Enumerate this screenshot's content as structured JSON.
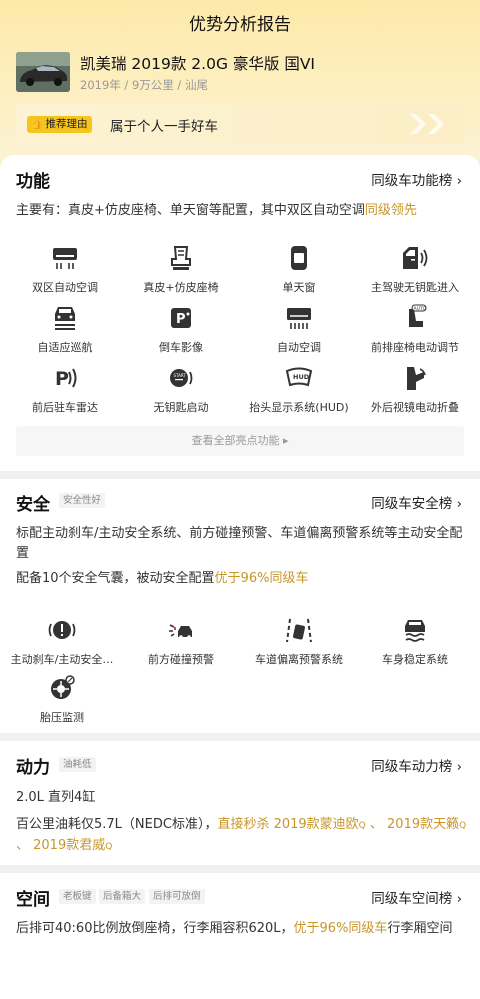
{
  "page": {
    "title": "优势分析报告"
  },
  "car": {
    "name": "凯美瑞 2019款 2.0G 豪华版 国VI",
    "meta": "2019年 / 9万公里 / 汕尾"
  },
  "reason": {
    "tag": "推荐理由",
    "text": "属于个人一手好车"
  },
  "function": {
    "title": "功能",
    "rank_link": "同级车功能榜 ›",
    "summary_prefix": "主要有：真皮+仿皮座椅、单天窗等配置，其中双区自动空调",
    "summary_highlight": "同级领先",
    "features": [
      {
        "label": "双区自动空调",
        "icon": "dual-zone-ac-icon"
      },
      {
        "label": "真皮+仿皮座椅",
        "icon": "leather-seat-icon"
      },
      {
        "label": "单天窗",
        "icon": "sunroof-icon"
      },
      {
        "label": "主驾驶无钥匙进入",
        "icon": "keyless-entry-icon"
      },
      {
        "label": "自适应巡航",
        "icon": "adaptive-cruise-icon"
      },
      {
        "label": "倒车影像",
        "icon": "reverse-camera-icon"
      },
      {
        "label": "自动空调",
        "icon": "auto-ac-icon"
      },
      {
        "label": "前排座椅电动调节",
        "icon": "power-seat-icon"
      },
      {
        "label": "前后驻车雷达",
        "icon": "parking-radar-icon"
      },
      {
        "label": "无钥匙启动",
        "icon": "keyless-start-icon"
      },
      {
        "label": "抬头显示系统(HUD)",
        "icon": "hud-icon"
      },
      {
        "label": "外后视镜电动折叠",
        "icon": "mirror-fold-icon"
      }
    ],
    "more": "查看全部亮点功能 ▸"
  },
  "safety": {
    "title": "安全",
    "tag": "安全性好",
    "rank_link": "同级车安全榜 ›",
    "line1": "标配主动刹车/主动安全系统、前方碰撞预警、车道偏离预警系统等主动安全配置",
    "line2_prefix": "配备10个安全气囊，被动安全配置",
    "line2_highlight": "优于96%同级车",
    "features": [
      {
        "label": "主动刹车/主动安全…",
        "icon": "active-brake-icon"
      },
      {
        "label": "前方碰撞预警",
        "icon": "collision-warning-icon"
      },
      {
        "label": "车道偏离预警系统",
        "icon": "lane-departure-icon"
      },
      {
        "label": "车身稳定系统",
        "icon": "stability-control-icon"
      },
      {
        "label": "胎压监测",
        "icon": "tire-pressure-icon"
      }
    ]
  },
  "power": {
    "title": "动力",
    "tag": "油耗低",
    "rank_link": "同级车动力榜 ›",
    "engine": "2.0L 直列4缸",
    "fuel_prefix": "百公里油耗仅5.7L（NEDC标准），",
    "fuel_hl1": "直接秒杀 2019款蒙迪欧",
    "sep1": " 、 ",
    "fuel_hl2": "2019款天籁",
    "sep2": " 、 ",
    "fuel_hl3": "2019款君威"
  },
  "space": {
    "title": "空间",
    "tags": [
      "老板键",
      "后备箱大",
      "后排可放倒"
    ],
    "rank_link": "同级车空间榜 ›",
    "text_prefix": "后排可40:60比例放倒座椅，行李厢容积620L，",
    "text_highlight": "优于96%同级车",
    "text_suffix": "行李厢空间"
  },
  "colors": {
    "accent": "#c8962a",
    "tag_yellow": "#f6c51d"
  }
}
